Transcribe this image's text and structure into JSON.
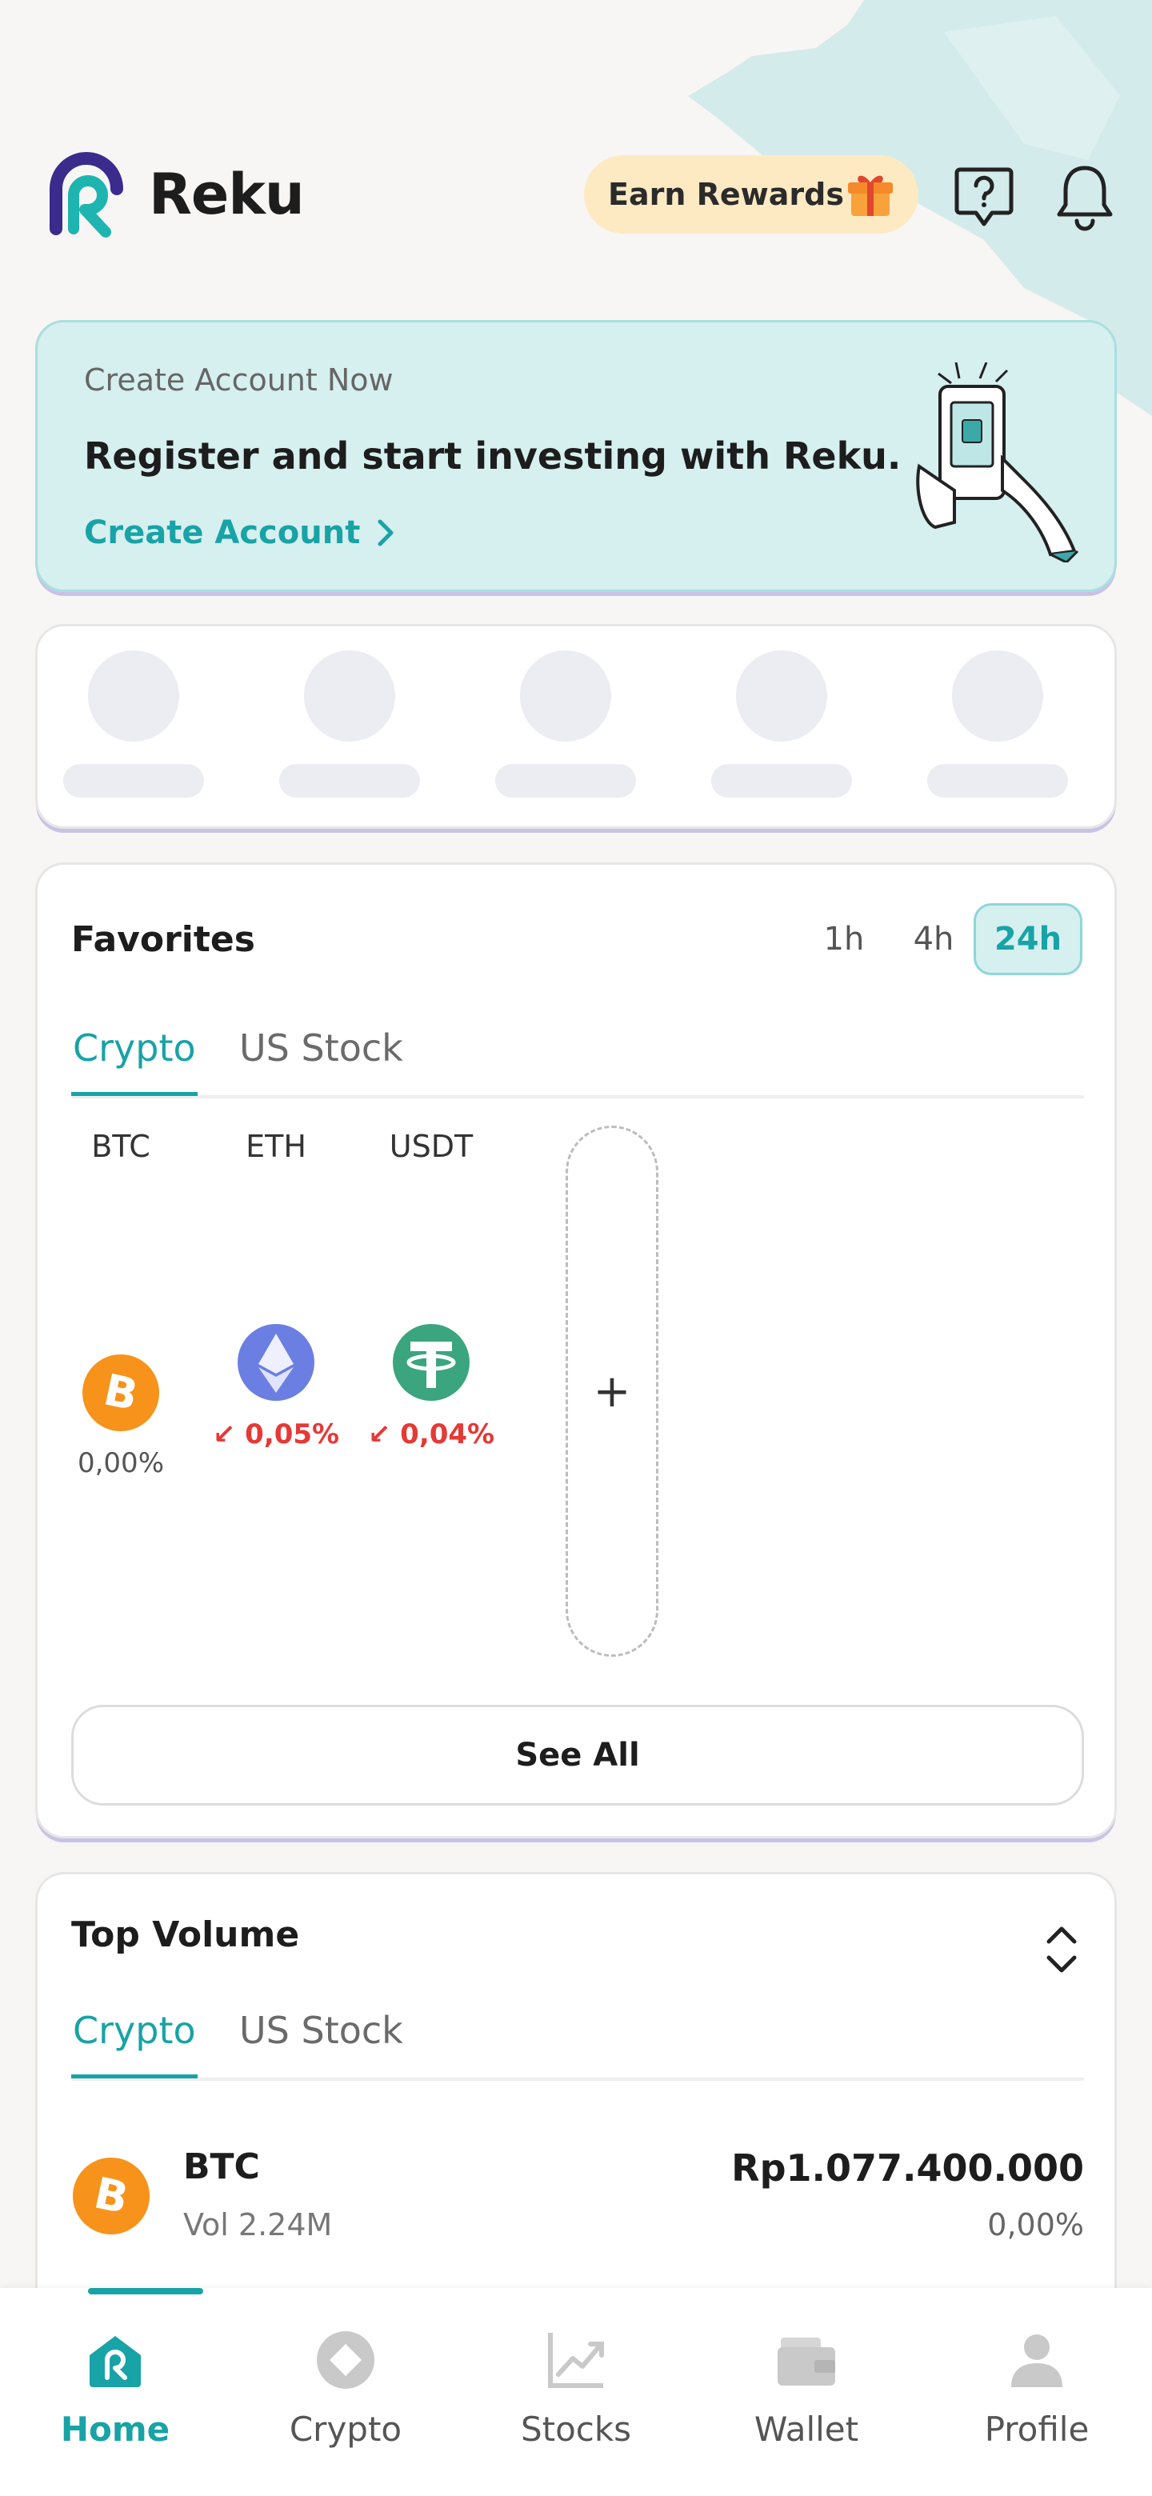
{
  "header": {
    "brand": "Reku",
    "earn_rewards": "Earn Rewards",
    "icons": [
      "logo-icon",
      "gift-icon",
      "help-icon",
      "bell-icon"
    ]
  },
  "promo": {
    "subtitle": "Create Account Now",
    "title": "Register and start investing with Reku.",
    "link_label": "Create Account"
  },
  "favorites": {
    "title": "Favorites",
    "timeframes": [
      "1h",
      "4h",
      "24h"
    ],
    "active_timeframe": "24h",
    "tabs": [
      "Crypto",
      "US Stock"
    ],
    "active_tab": "Crypto",
    "coins": [
      {
        "ticker": "BTC",
        "change": "0,00%",
        "direction": "neutral",
        "icon": "bitcoin-icon"
      },
      {
        "ticker": "ETH",
        "change": "0,05%",
        "direction": "down",
        "icon": "ethereum-icon"
      },
      {
        "ticker": "USDT",
        "change": "0,04%",
        "direction": "down",
        "icon": "tether-icon"
      }
    ],
    "add_label": "+",
    "see_all": "See All"
  },
  "top_volume": {
    "title": "Top Volume",
    "tabs": [
      "Crypto",
      "US Stock"
    ],
    "active_tab": "Crypto",
    "rows": [
      {
        "ticker": "BTC",
        "volume": "Vol 2.24M",
        "price": "Rp1.077.400.000",
        "change": "0,00%"
      }
    ]
  },
  "nav": {
    "items": [
      {
        "label": "Home",
        "icon": "home-icon"
      },
      {
        "label": "Crypto",
        "icon": "crypto-icon"
      },
      {
        "label": "Stocks",
        "icon": "stocks-icon"
      },
      {
        "label": "Wallet",
        "icon": "wallet-icon"
      },
      {
        "label": "Profile",
        "icon": "profile-icon"
      }
    ],
    "active": "Home"
  },
  "colors": {
    "accent": "#18a3a6",
    "down": "#e53935",
    "earn_bg": "#fdeac3",
    "promo_bg": "#d6efef"
  }
}
